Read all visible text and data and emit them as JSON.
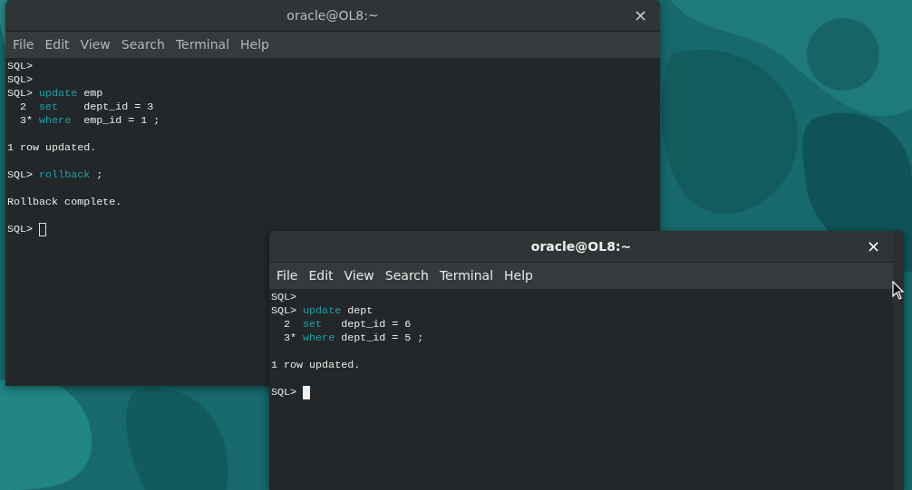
{
  "windows": [
    {
      "title": "oracle@OL8:~",
      "close": "×",
      "focused": false,
      "menu": [
        "File",
        "Edit",
        "View",
        "Search",
        "Terminal",
        "Help"
      ],
      "lines": [
        {
          "kind": "text",
          "segments": [
            {
              "text": "SQL>",
              "kind": "plain"
            }
          ]
        },
        {
          "kind": "text",
          "segments": [
            {
              "text": "SQL>",
              "kind": "plain"
            }
          ]
        },
        {
          "kind": "text",
          "segments": [
            {
              "text": "SQL> ",
              "kind": "plain"
            },
            {
              "text": "update",
              "kind": "keyword"
            },
            {
              "text": " emp",
              "kind": "plain"
            }
          ]
        },
        {
          "kind": "text",
          "segments": [
            {
              "text": "  2  ",
              "kind": "plain"
            },
            {
              "text": "set",
              "kind": "keyword"
            },
            {
              "text": "    dept_id = 3",
              "kind": "plain"
            }
          ]
        },
        {
          "kind": "text",
          "segments": [
            {
              "text": "  3* ",
              "kind": "plain"
            },
            {
              "text": "where",
              "kind": "keyword"
            },
            {
              "text": "  emp_id = 1 ;",
              "kind": "plain"
            }
          ]
        },
        {
          "kind": "blank"
        },
        {
          "kind": "text",
          "segments": [
            {
              "text": "1 row updated.",
              "kind": "plain"
            }
          ]
        },
        {
          "kind": "blank"
        },
        {
          "kind": "text",
          "segments": [
            {
              "text": "SQL> ",
              "kind": "plain"
            },
            {
              "text": "rollback",
              "kind": "keyword"
            },
            {
              "text": " ;",
              "kind": "plain"
            }
          ]
        },
        {
          "kind": "blank"
        },
        {
          "kind": "text",
          "segments": [
            {
              "text": "Rollback complete.",
              "kind": "plain"
            }
          ]
        },
        {
          "kind": "blank"
        },
        {
          "kind": "prompt",
          "segments": [
            {
              "text": "SQL> ",
              "kind": "plain"
            }
          ]
        }
      ]
    },
    {
      "title": "oracle@OL8:~",
      "close": "×",
      "focused": true,
      "menu": [
        "File",
        "Edit",
        "View",
        "Search",
        "Terminal",
        "Help"
      ],
      "lines": [
        {
          "kind": "text",
          "segments": [
            {
              "text": "SQL>",
              "kind": "plain"
            }
          ]
        },
        {
          "kind": "text",
          "segments": [
            {
              "text": "SQL> ",
              "kind": "plain"
            },
            {
              "text": "update",
              "kind": "keyword"
            },
            {
              "text": " dept",
              "kind": "plain"
            }
          ]
        },
        {
          "kind": "text",
          "segments": [
            {
              "text": "  2  ",
              "kind": "plain"
            },
            {
              "text": "set",
              "kind": "keyword"
            },
            {
              "text": "   dept_id = 6",
              "kind": "plain"
            }
          ]
        },
        {
          "kind": "text",
          "segments": [
            {
              "text": "  3* ",
              "kind": "plain"
            },
            {
              "text": "where",
              "kind": "keyword"
            },
            {
              "text": " dept_id = 5 ;",
              "kind": "plain"
            }
          ]
        },
        {
          "kind": "blank"
        },
        {
          "kind": "text",
          "segments": [
            {
              "text": "1 row updated.",
              "kind": "plain"
            }
          ]
        },
        {
          "kind": "blank"
        },
        {
          "kind": "prompt",
          "segments": [
            {
              "text": "SQL> ",
              "kind": "plain"
            }
          ]
        }
      ]
    }
  ]
}
